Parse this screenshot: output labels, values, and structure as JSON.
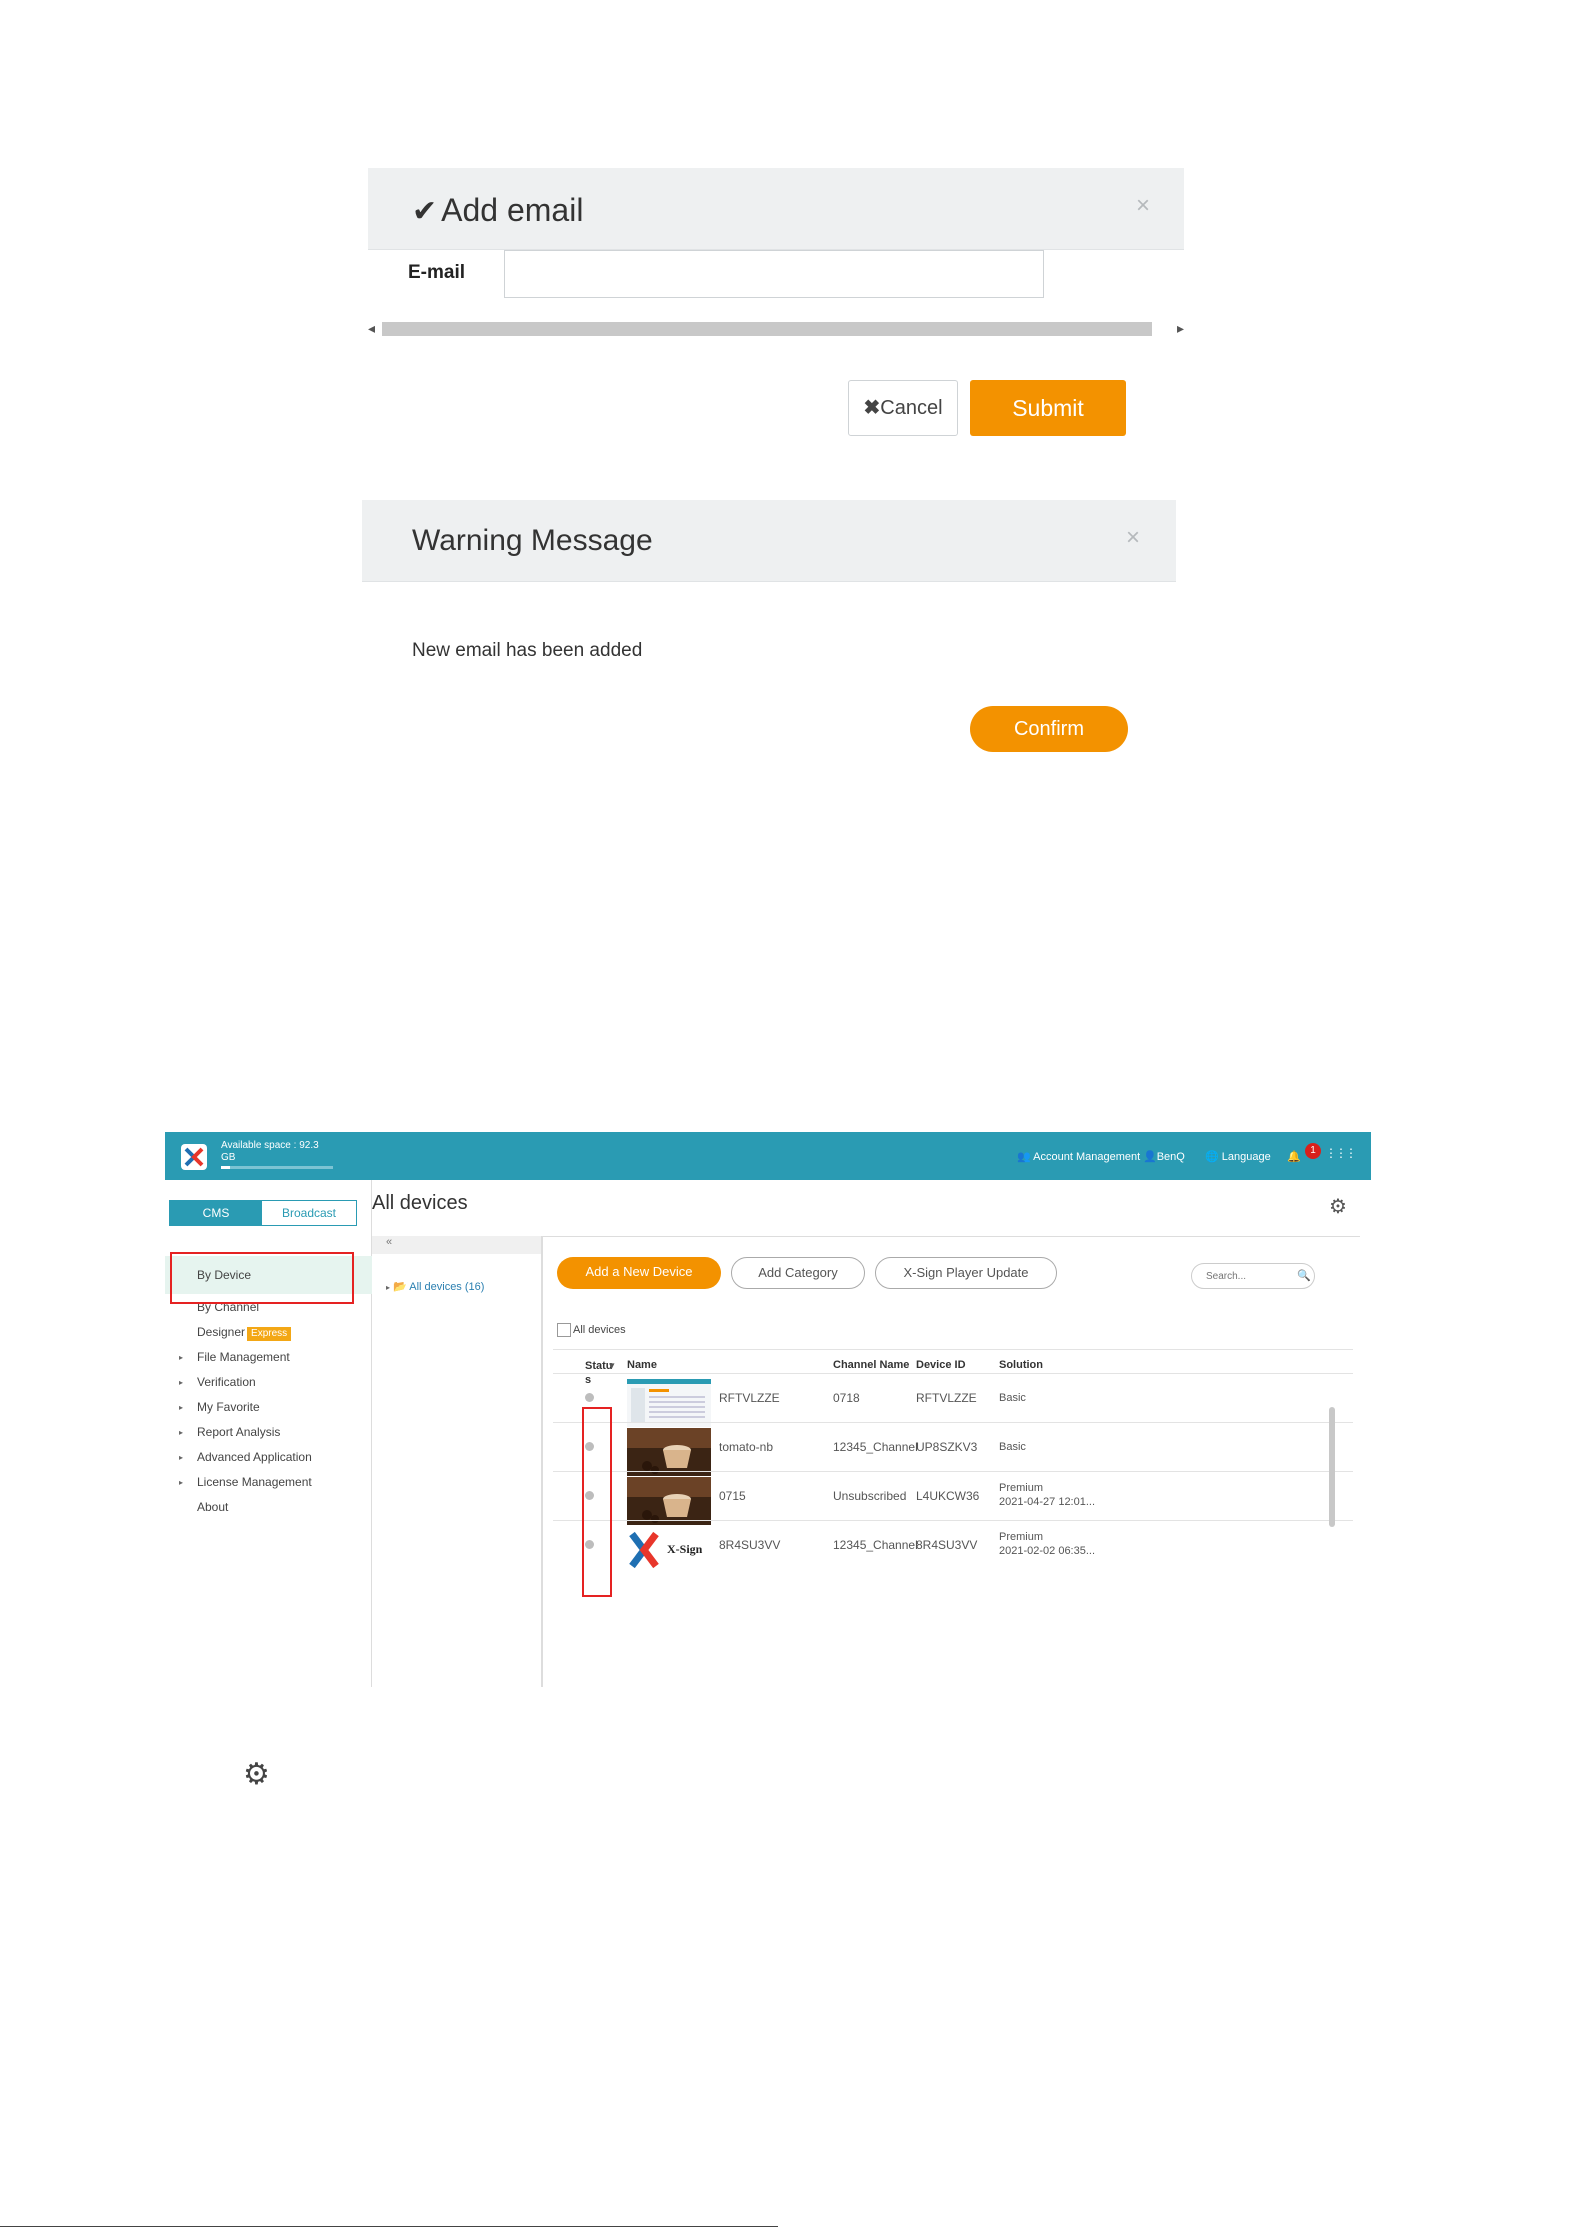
{
  "add_email_dialog": {
    "check_glyph": "✔",
    "title": "Add email",
    "close_glyph": "×",
    "email_label": "E-mail",
    "email_value": "",
    "email_placeholder": "",
    "scroll_left": "◂",
    "scroll_right": "▸",
    "cancel_glyph": "✖",
    "cancel_label": "Cancel",
    "submit_label": "Submit"
  },
  "warning_dialog": {
    "title": "Warning Message",
    "close_glyph": "×",
    "message": "New email has been added",
    "confirm_label": "Confirm"
  },
  "app": {
    "topbar": {
      "space_label": "Available space : 92.3",
      "space_unit": "GB",
      "space_used_fraction": 0.08,
      "account_icon": "👥",
      "account_label": "Account Management",
      "user_icon": "👤",
      "user_label": "BenQ",
      "language_icon": "🌐",
      "language_label": "Language",
      "bell_icon": "🔔",
      "notification_count": "1",
      "apps_icon": "⋮⋮⋮"
    },
    "sidebar": {
      "tab_cms": "CMS",
      "tab_broadcast": "Broadcast",
      "items": [
        {
          "label": "By Device",
          "has_caret": false
        },
        {
          "label": "By Channel",
          "has_caret": false
        },
        {
          "label": "Designer",
          "has_caret": false,
          "badge": "Express"
        },
        {
          "label": "File Management",
          "has_caret": true
        },
        {
          "label": "Verification",
          "has_caret": true
        },
        {
          "label": "My Favorite",
          "has_caret": true
        },
        {
          "label": "Report Analysis",
          "has_caret": true
        },
        {
          "label": "Advanced Application",
          "has_caret": true
        },
        {
          "label": "License Management",
          "has_caret": true
        },
        {
          "label": "About",
          "has_caret": false
        }
      ],
      "caret_glyph": "▸"
    },
    "page_title": "All devices",
    "settings_icon": "⚙",
    "tree": {
      "collapse_glyph": "«",
      "node_caret": "▸",
      "folder_icon": "📂",
      "node_label": "All devices (16)"
    },
    "toolbar": {
      "add_device": "Add a New Device",
      "add_category": "Add Category",
      "player_update": "X-Sign Player Update",
      "search_placeholder": "Search...",
      "search_icon": "🔍"
    },
    "table": {
      "select_all_label": "All devices",
      "sort_glyph": "▾",
      "headers": {
        "status": "Statu\ns",
        "name": "Name",
        "channel": "Channel Name",
        "device_id": "Device ID",
        "solution": "Solution"
      },
      "rows": [
        {
          "name": "RFTVLZZE",
          "channel": "0718",
          "device_id": "RFTVLZZE",
          "solution": "Basic",
          "solution_date": "",
          "thumb": "screenshot"
        },
        {
          "name": "tomato-nb",
          "channel": "12345_Channel",
          "device_id": "UP8SZKV3",
          "solution": "Basic",
          "solution_date": "",
          "thumb": "coffee"
        },
        {
          "name": "0715",
          "channel": "Unsubscribed",
          "device_id": "L4UKCW36",
          "solution": "Premium",
          "solution_date": "2021-04-27 12:01...",
          "thumb": "coffee"
        },
        {
          "name": "8R4SU3VV",
          "channel": "12345_Channel",
          "device_id": "8R4SU3VV",
          "solution": "Premium",
          "solution_date": "2021-02-02 06:35...",
          "thumb": "xsign"
        }
      ],
      "xsign_logo_text": "X-Sign"
    },
    "colors": {
      "brand_teal": "#2a9bb3",
      "accent_orange": "#f39200",
      "highlight_red": "#e52222"
    }
  },
  "bottom_gear_icon": "⚙"
}
